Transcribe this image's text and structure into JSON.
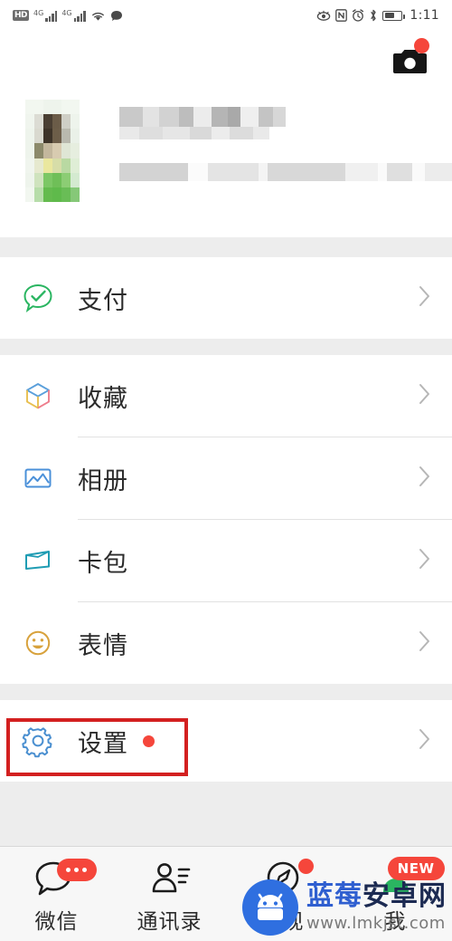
{
  "statusbar": {
    "hd_label": "HD",
    "network1": "4G",
    "network2": "4G",
    "icons": [
      "hd-badge",
      "signal-4g-icon",
      "signal-4g-icon",
      "wifi-icon",
      "chat-bubble-icon",
      "eye-care-icon",
      "nfc-icon",
      "alarm-clock-icon",
      "bluetooth-icon",
      "battery-icon"
    ],
    "time": "1:11"
  },
  "header": {
    "camera_icon": "camera-icon",
    "camera_has_badge": true
  },
  "profile": {
    "avatar": "blurred-user-avatar",
    "name": "",
    "subtitle": "",
    "redacted": true
  },
  "menu_groups": [
    {
      "items": [
        {
          "label": "支付",
          "icon": "pay-icon",
          "badge": false,
          "highlighted": false
        }
      ]
    },
    {
      "items": [
        {
          "label": "收藏",
          "icon": "favorites-box-icon",
          "badge": false,
          "highlighted": false
        },
        {
          "label": "相册",
          "icon": "album-photo-icon",
          "badge": false,
          "highlighted": false
        },
        {
          "label": "卡包",
          "icon": "cards-wallet-icon",
          "badge": false,
          "highlighted": false
        },
        {
          "label": "表情",
          "icon": "sticker-smiley-icon",
          "badge": false,
          "highlighted": false
        }
      ]
    },
    {
      "items": [
        {
          "label": "设置",
          "icon": "settings-gear-icon",
          "badge": true,
          "highlighted": true
        }
      ]
    }
  ],
  "tabbar": {
    "tabs": [
      {
        "label": "微信",
        "icon": "chat-bubble-icon",
        "badge": "dots"
      },
      {
        "label": "通讯录",
        "icon": "contacts-icon",
        "badge": "none"
      },
      {
        "label": "发现",
        "icon": "compass-discover-icon",
        "badge": "dot"
      },
      {
        "label": "我",
        "icon": "me-person-icon",
        "badge": "NEW"
      }
    ]
  },
  "watermark": {
    "brand_blue": "蓝莓",
    "brand_dark": "安卓网",
    "url": "www.lmkjst.com",
    "logo": "android-robot-logo"
  },
  "annotation": {
    "target": "设置",
    "color": "#d32020"
  },
  "colors": {
    "accent_red": "#f5463b",
    "pay_green": "#2ab561",
    "album_blue": "#4a90d9",
    "cards_teal": "#1f9cb3",
    "sticker_orange": "#d8a23c",
    "gear_blue": "#4a8fd0",
    "page_bg": "#ededed",
    "card_bg": "#ffffff",
    "annotation_red": "#d32020"
  }
}
